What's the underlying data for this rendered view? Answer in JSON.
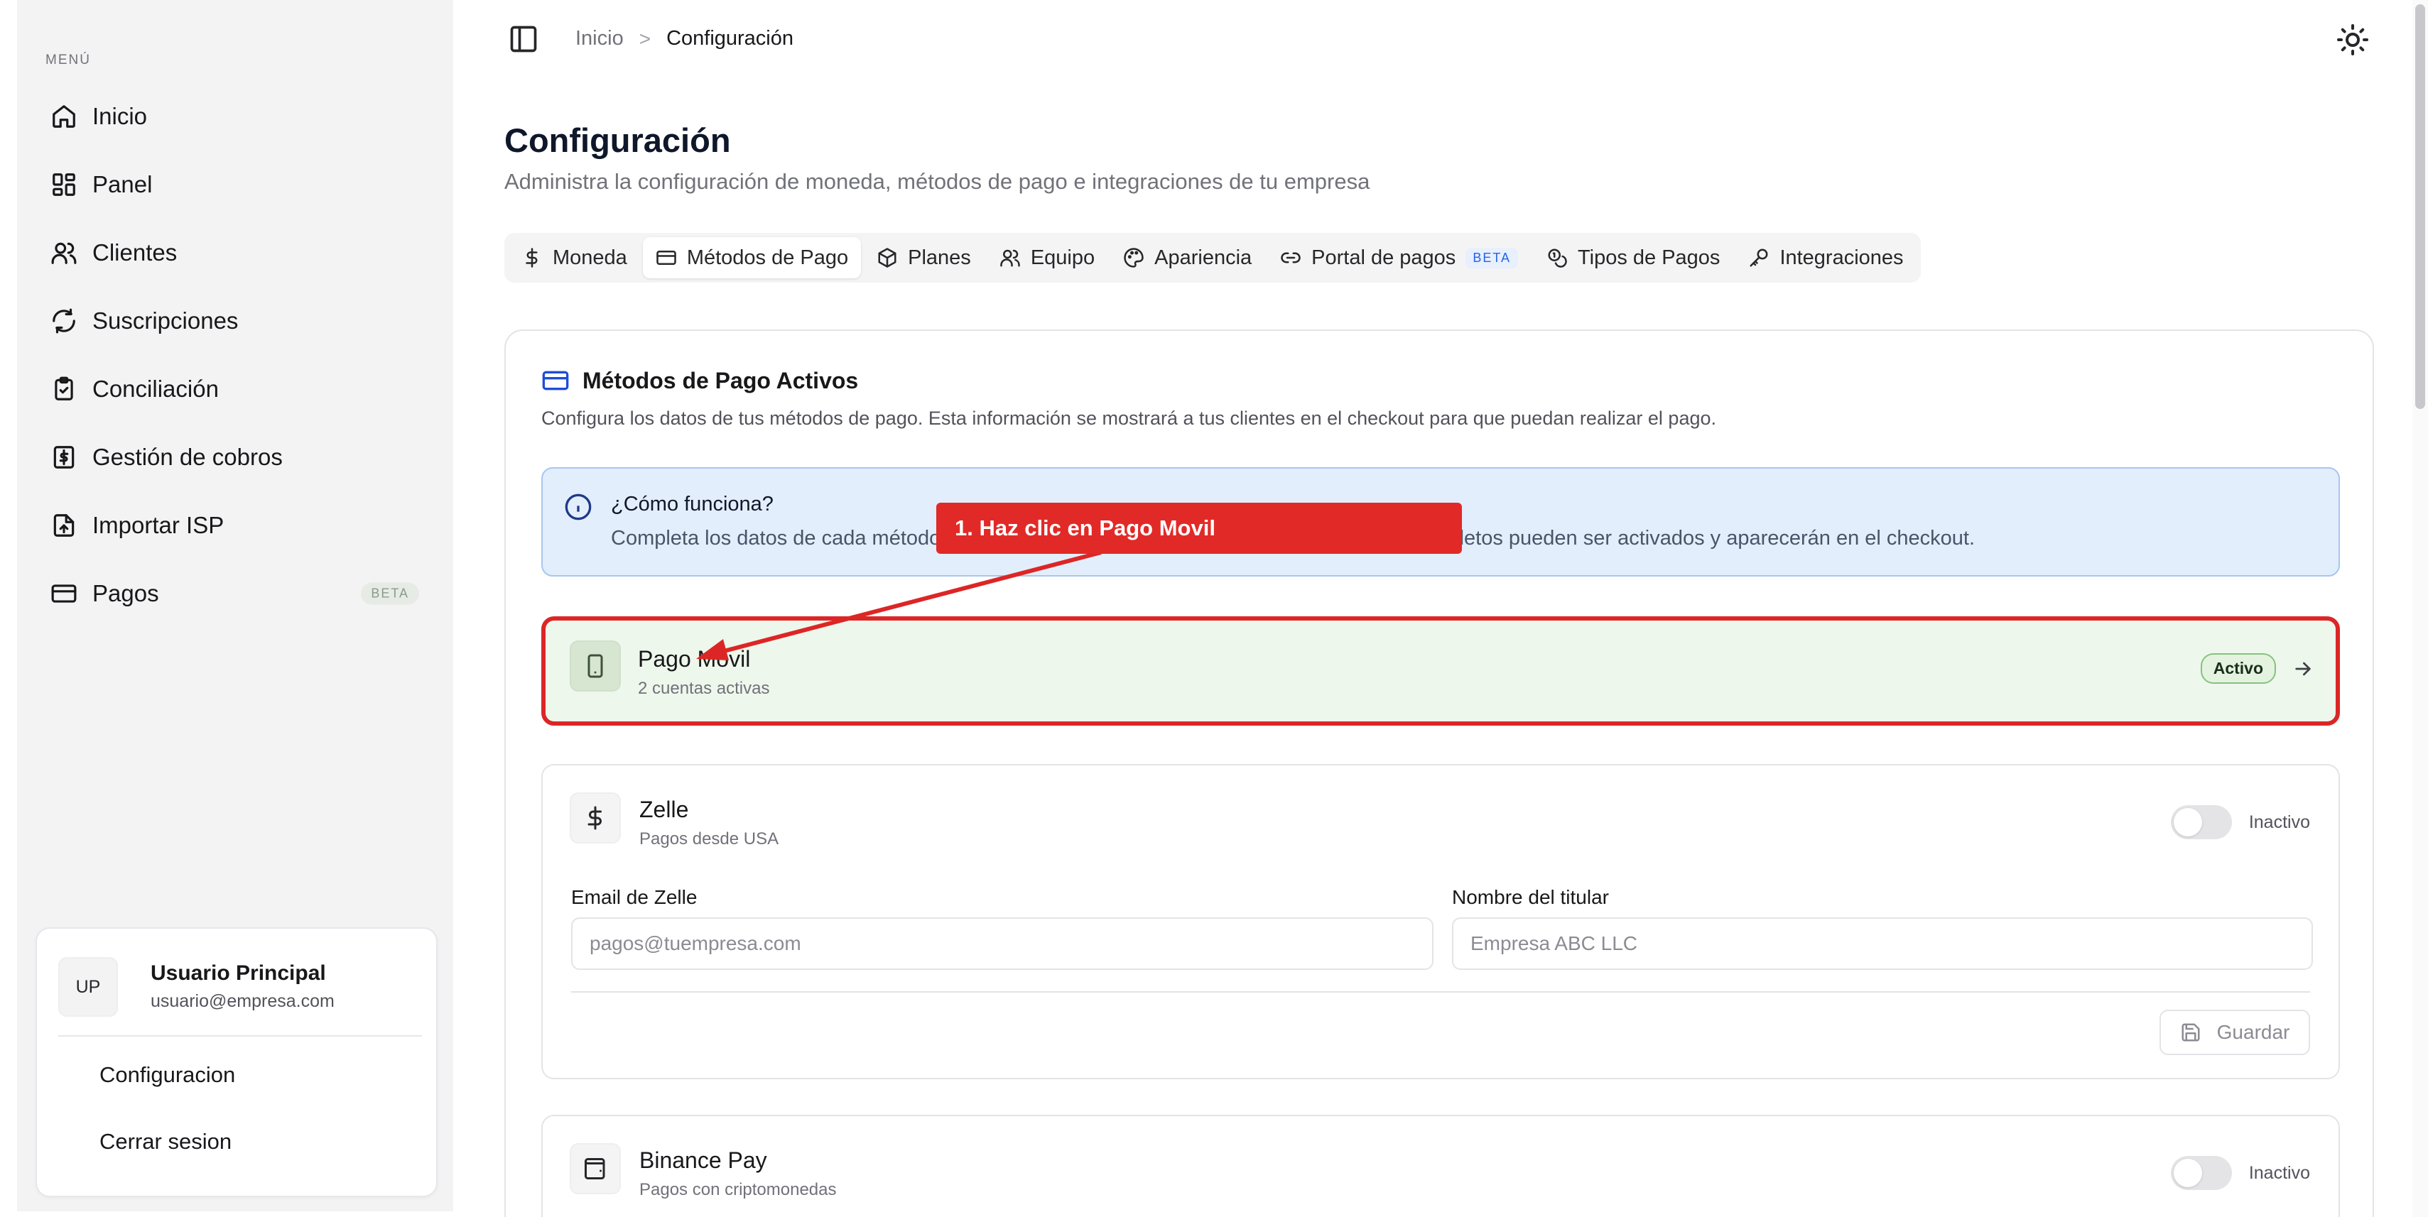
{
  "sidebar": {
    "menu_label": "MENÚ",
    "items": [
      {
        "label": "Inicio",
        "icon": "home-icon"
      },
      {
        "label": "Panel",
        "icon": "layout-dashboard-icon"
      },
      {
        "label": "Clientes",
        "icon": "users-icon"
      },
      {
        "label": "Suscripciones",
        "icon": "refresh-icon"
      },
      {
        "label": "Conciliación",
        "icon": "clipboard-check-icon"
      },
      {
        "label": "Gestión de cobros",
        "icon": "dollar-receipt-icon"
      },
      {
        "label": "Importar ISP",
        "icon": "file-upload-icon"
      },
      {
        "label": "Pagos",
        "icon": "credit-card-icon",
        "badge": "BETA"
      }
    ],
    "user": {
      "initials": "UP",
      "name": "Usuario Principal",
      "email": "usuario@empresa.com",
      "links": [
        "Configuracion",
        "Cerrar sesion"
      ]
    }
  },
  "header": {
    "breadcrumb": [
      "Inicio",
      "Configuración"
    ],
    "separator": ">"
  },
  "page": {
    "title": "Configuración",
    "subtitle": "Administra la configuración de moneda, métodos de pago e integraciones de tu empresa"
  },
  "tabs": [
    {
      "label": "Moneda",
      "icon": "dollar-icon",
      "active": false
    },
    {
      "label": "Métodos de Pago",
      "icon": "credit-card-icon",
      "active": true
    },
    {
      "label": "Planes",
      "icon": "package-icon",
      "active": false
    },
    {
      "label": "Equipo",
      "icon": "users-icon",
      "active": false
    },
    {
      "label": "Apariencia",
      "icon": "palette-icon",
      "active": false
    },
    {
      "label": "Portal de pagos",
      "icon": "link-icon",
      "active": false,
      "badge": "BETA"
    },
    {
      "label": "Tipos de Pagos",
      "icon": "coins-icon",
      "active": false
    },
    {
      "label": "Integraciones",
      "icon": "key-icon",
      "active": false
    }
  ],
  "card": {
    "title": "Métodos de Pago Activos",
    "description": "Configura los datos de tus métodos de pago. Esta información se mostrará a tus clientes en el checkout para que puedan realizar el pago.",
    "info": {
      "title": "¿Cómo funciona?",
      "text": "Completa los datos de cada método de pago que aceptas. Solo los métodos con datos completos pueden ser activados y aparecerán en el checkout."
    }
  },
  "methods": {
    "pago_movil": {
      "name": "Pago Movil",
      "sub": "2 cuentas activas",
      "status": "Activo"
    },
    "zelle": {
      "name": "Zelle",
      "sub": "Pagos desde USA",
      "status": "Inactivo",
      "email_label": "Email de Zelle",
      "email_placeholder": "pagos@tuempresa.com",
      "holder_label": "Nombre del titular",
      "holder_placeholder": "Empresa ABC LLC",
      "save_label": "Guardar"
    },
    "binance": {
      "name": "Binance Pay",
      "sub": "Pagos con criptomonedas",
      "status": "Inactivo"
    }
  },
  "annotation": {
    "text": "1. Haz clic en Pago Movil"
  },
  "colors": {
    "accent_red": "#dc2626",
    "active_bg": "#eef7ec",
    "info_bg": "#e3eefc"
  }
}
